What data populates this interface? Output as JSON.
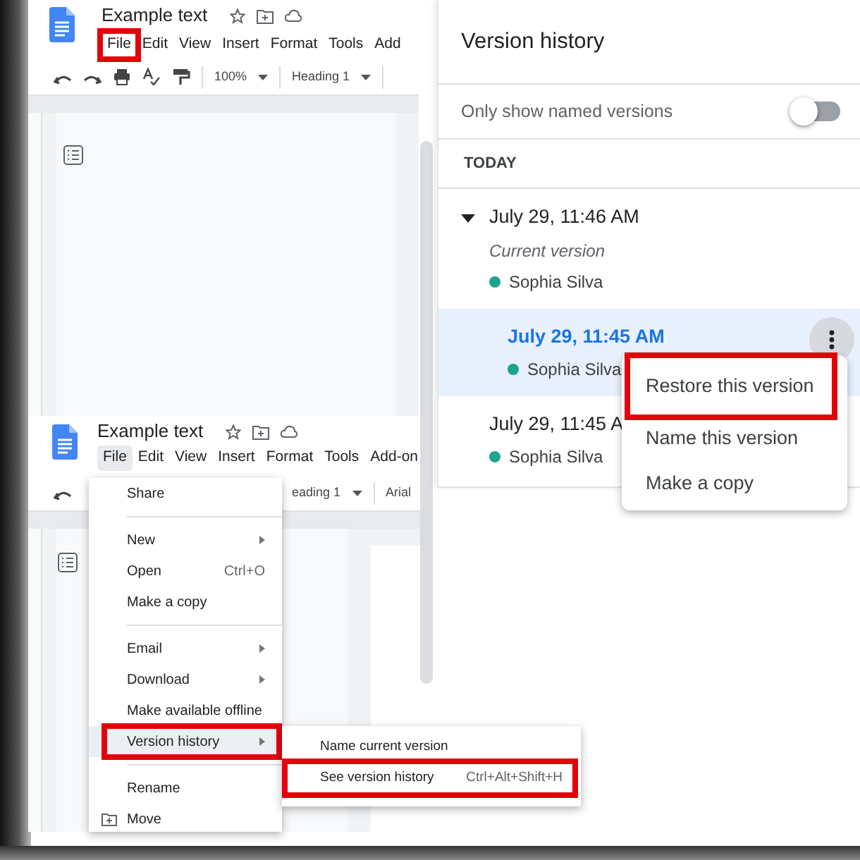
{
  "doc_windows": [
    {
      "title": "Example text",
      "menu": [
        {
          "label": "File",
          "selected": false,
          "highlighted": true
        },
        {
          "label": "Edit",
          "selected": false,
          "highlighted": false
        },
        {
          "label": "View",
          "selected": false,
          "highlighted": false
        },
        {
          "label": "Insert",
          "selected": false,
          "highlighted": false
        },
        {
          "label": "Format",
          "selected": false,
          "highlighted": false
        },
        {
          "label": "Tools",
          "selected": false,
          "highlighted": false
        },
        {
          "label": "Add",
          "selected": false,
          "highlighted": false
        }
      ],
      "toolbar": [
        {
          "kind": "undo"
        },
        {
          "kind": "redo"
        },
        {
          "kind": "print"
        },
        {
          "kind": "spellcheck"
        },
        {
          "kind": "paint"
        },
        {
          "kind": "sep"
        },
        {
          "kind": "dropdown",
          "label": "100%"
        },
        {
          "kind": "sep"
        },
        {
          "kind": "dropdown",
          "label": "Heading 1"
        },
        {
          "kind": "sep"
        }
      ]
    },
    {
      "title": "Example text",
      "menu": [
        {
          "label": "File",
          "selected": true,
          "highlighted": false
        },
        {
          "label": "Edit",
          "selected": false,
          "highlighted": false
        },
        {
          "label": "View",
          "selected": false,
          "highlighted": false
        },
        {
          "label": "Insert",
          "selected": false,
          "highlighted": false
        },
        {
          "label": "Format",
          "selected": false,
          "highlighted": false
        },
        {
          "label": "Tools",
          "selected": false,
          "highlighted": false
        },
        {
          "label": "Add-on",
          "selected": false,
          "highlighted": false
        }
      ],
      "toolbar": [
        {
          "kind": "undo"
        },
        {
          "kind": "gap"
        },
        {
          "kind": "dropdown",
          "label": "eading 1"
        },
        {
          "kind": "sep"
        },
        {
          "kind": "text",
          "label": "Arial"
        }
      ]
    }
  ],
  "file_menu": {
    "items": [
      {
        "kind": "item",
        "label": "Share"
      },
      {
        "kind": "divider"
      },
      {
        "kind": "item",
        "label": "New",
        "submenu": true
      },
      {
        "kind": "item",
        "label": "Open",
        "shortcut": "Ctrl+O"
      },
      {
        "kind": "item",
        "label": "Make a copy"
      },
      {
        "kind": "divider"
      },
      {
        "kind": "item",
        "label": "Email",
        "submenu": true
      },
      {
        "kind": "item",
        "label": "Download",
        "submenu": true
      },
      {
        "kind": "item",
        "label": "Make available offline"
      },
      {
        "kind": "item",
        "label": "Version history",
        "submenu": true,
        "selected": true,
        "highlighted": true
      },
      {
        "kind": "divider"
      },
      {
        "kind": "item",
        "label": "Rename"
      },
      {
        "kind": "folder-item",
        "label": "Move"
      }
    ]
  },
  "submenu": {
    "items": [
      {
        "label": "Name current version",
        "highlighted": false
      },
      {
        "label": "See version history",
        "shortcut": "Ctrl+Alt+Shift+H",
        "highlighted": true
      }
    ]
  },
  "version_history": {
    "title": "Version history",
    "filter": {
      "label": "Only show named versions",
      "on": false
    },
    "section": "TODAY",
    "versions": [
      {
        "time": "July 29, 11:46 AM",
        "expanded": true,
        "note": "Current version",
        "author": "Sophia Silva",
        "color": "#1aa58f",
        "selected": false
      },
      {
        "time": "July 29, 11:45 AM",
        "author": "Sophia Silva",
        "color": "#1aa58f",
        "selected": true
      },
      {
        "time": "July 29, 11:45 A",
        "author": "Sophia Silva",
        "color": "#1aa58f",
        "selected": false
      }
    ],
    "context_menu": {
      "items": [
        {
          "label": "Restore this version",
          "highlighted": true
        },
        {
          "label": "Name this version",
          "highlighted": false
        },
        {
          "label": "Make a copy",
          "highlighted": false
        }
      ]
    }
  }
}
